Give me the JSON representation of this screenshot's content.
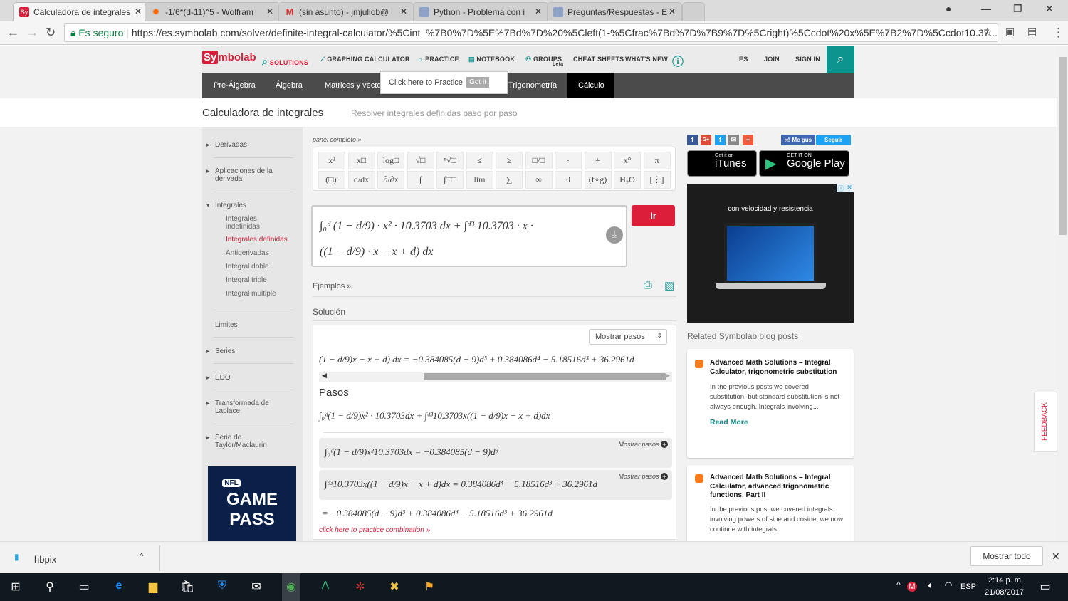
{
  "browser": {
    "tabs": [
      {
        "title": "Calculadora de integrales",
        "icon": "symbolab-favicon",
        "active": true
      },
      {
        "title": "-1/6*(d-11)^5 - Wolfram",
        "icon": "wolfram-favicon"
      },
      {
        "title": "(sin asunto) - jmjuliob@",
        "icon": "gmail-favicon"
      },
      {
        "title": "Python - Problema con i",
        "icon": "stackoverflow-favicon"
      },
      {
        "title": "Preguntas/Respuestas - E",
        "icon": "stackoverflow-favicon"
      }
    ],
    "secure_label": "Es seguro",
    "url": "https://es.symbolab.com/solver/definite-integral-calculator/%5Cint_%7B0%7D%5E%7Bd%7D%20%5Cleft(1-%5Cfrac%7Bd%7D%7B9%7D%5Cright)%5Ccdot%20x%5E%7B2%7D%5Ccdot10.37..."
  },
  "topnav": {
    "logo_sy": "Sy",
    "logo_rest": "mbolab",
    "items": [
      "SOLUTIONS",
      "GRAPHING CALCULATOR",
      "PRACTICE",
      "NOTEBOOK",
      "GROUPS",
      "CHEAT SHEETS",
      "WHAT'S NEW"
    ],
    "groups_badge": "beta",
    "lang": "ES",
    "join": "JOIN",
    "signin": "SIGN IN"
  },
  "subnav": {
    "items": [
      "Pre-Álgebra",
      "Álgebra",
      "Matrices y vectores",
      "Trigonometría",
      "Cálculo"
    ],
    "active": "Cálculo"
  },
  "tooltip": {
    "text": "Click here to Practice",
    "button": "Got it"
  },
  "page": {
    "title": "Calculadora de integrales",
    "subtitle": "Resolver integrales definidas paso por paso"
  },
  "sidebar": {
    "items": [
      {
        "label": "Derivadas"
      },
      {
        "label": "Aplicaciones de la derivada"
      },
      {
        "label": "Integrales"
      },
      {
        "label": "Integrales indefinidas"
      },
      {
        "label": "Integrales definidas"
      },
      {
        "label": "Antiderivadas"
      },
      {
        "label": "Integral doble"
      },
      {
        "label": "Integral triple"
      },
      {
        "label": "Integral multiple"
      },
      {
        "label": "Limites"
      },
      {
        "label": "Series"
      },
      {
        "label": "EDO"
      },
      {
        "label": "Transformada de Laplace"
      },
      {
        "label": "Serie de Taylor/Maclaurin"
      }
    ],
    "ad": {
      "brand": "NFL",
      "line1": "GAME",
      "line2": "PASS"
    }
  },
  "calculator": {
    "panel_link": "panel completo »",
    "keys_row1": [
      "x²",
      "x□",
      "log□",
      "√□",
      "ⁿ√□",
      "≤",
      "≥",
      "□/□",
      "·",
      "÷",
      "x°",
      "π"
    ],
    "keys_row2": [
      "(□)'",
      "d/dx",
      "∂/∂x",
      "∫",
      "∫□□",
      "lim",
      "∑",
      "∞",
      "θ",
      "(f∘g)",
      "H₂O",
      "[⋮]"
    ],
    "input_line1": "∫₀ᵈ (1 − d/9) · x² · 10.3703 dx + ∫ᵈ³ 10.3703 · x ·",
    "input_line2": "((1 − d/9) · x − x + d) dx",
    "go_button": "Ir",
    "examples": "Ejemplos »",
    "solution_label": "Solución"
  },
  "solution": {
    "show_steps_select": "Mostrar pasos",
    "result": "(1 − d/9)x − x + d) dx = −0.384085(d − 9)d³ + 0.384086d⁴ − 5.18516d³ + 36.2961d",
    "steps_title": "Pasos",
    "step_expr": "∫₀ᵈ(1 − d/9)x² · 10.3703dx + ∫ᵈ³10.3703x((1 − d/9)x − x + d)dx",
    "steps": [
      {
        "expr": "∫₀ᵈ(1 − d/9)x²10.3703dx = −0.384085(d − 9)d³",
        "link": "Mostrar pasos"
      },
      {
        "expr": "∫ᵈ³10.3703x((1 − d/9)x − x + d)dx = 0.384086d⁴ − 5.18516d³ + 36.2961d",
        "link": "Mostrar pasos"
      }
    ],
    "final": "= −0.384085(d − 9)d³ + 0.384086d⁴ − 5.18516d³ + 36.2961d",
    "practice_link": "click here to practice combination »"
  },
  "right": {
    "social": [
      "f",
      "G+",
      "t",
      "✉",
      "+"
    ],
    "like": "Me gus",
    "follow": "Seguir",
    "itunes_small": "Get it on",
    "itunes_big": "iTunes",
    "gplay_small": "GET IT ON",
    "gplay_big": "Google Play",
    "ad_text": "con velocidad y resistencia",
    "blog_title": "Related Symbolab blog posts",
    "posts": [
      {
        "title": "Advanced Math Solutions – Integral Calculator, trigonometric substitution",
        "excerpt": "In the previous posts we covered substitution, but standard substitution is not always enough. Integrals involving...",
        "link": "Read More"
      },
      {
        "title": "Advanced Math Solutions – Integral Calculator, advanced trigonometric functions, Part II",
        "excerpt": "In the previous post we covered integrals involving powers of sine and cosine, we now continue with integrals"
      }
    ],
    "feedback": "FEEDBACK"
  },
  "downloads": {
    "file": "hbpix",
    "show_all": "Mostrar todo"
  },
  "taskbar": {
    "lang": "ESP",
    "time": "2:14 p. m.",
    "date": "21/08/2017"
  },
  "colors": {
    "brand_red": "#d8203a",
    "teal": "#0c948f",
    "subnav": "#4b4b4b"
  }
}
